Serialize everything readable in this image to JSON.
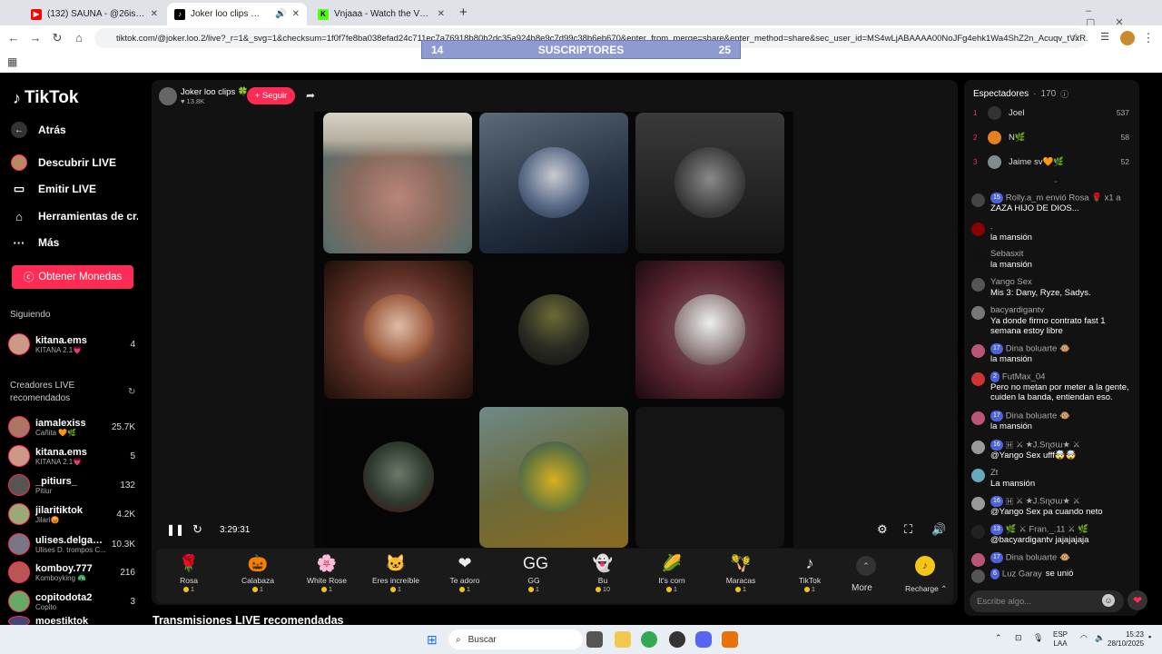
{
  "browser": {
    "tabs": [
      {
        "title": "(132) SAUNA - @26is - YouTube",
        "active": false
      },
      {
        "title": "Joker loo clips 🍀 (@joker.l",
        "active": true
      },
      {
        "title": "Vnjaaa - Watch the VOD on Kick",
        "active": false
      }
    ],
    "new_tab": "+",
    "url": "tiktok.com/@joker.loo.2/live?_r=1&_svg=1&checksum=1f0f7fe8ba038efad24c711ec7a76918b80b2dc35a924b8e9c7d99c38b6eb670&enter_from_merge=share&enter_method=share&sec_user_id=MS4wLjABAAAA00NoJFg4ehk1Wa4ShZ2n_Acuqv_tVxR..."
  },
  "overlay": {
    "left": "14",
    "label": "SUSCRIPTORES",
    "right": "25"
  },
  "sidebar": {
    "logo": "TikTok",
    "nav": [
      {
        "label": "Atrás",
        "icon": "arrow-left-icon"
      },
      {
        "label": "Descubrir LIVE",
        "icon": "live-avatar-icon"
      },
      {
        "label": "Emitir LIVE",
        "icon": "camera-icon"
      },
      {
        "label": "Herramientas de cr...",
        "icon": "house-icon"
      },
      {
        "label": "Más",
        "icon": "more-icon"
      }
    ],
    "coins_button": "Obtener Monedas",
    "following_title": "Siguiendo",
    "following": [
      {
        "name": "kitana.ems",
        "sub": "KITANA 2.1💗",
        "count": "4"
      }
    ],
    "recommended_title": "Creadores LIVE recomendados",
    "recommended": [
      {
        "name": "iamalexiss",
        "sub": "Cañita 🧡🌿",
        "count": "25.7K"
      },
      {
        "name": "kitana.ems",
        "sub": "KITANA 2.1💗",
        "count": "5"
      },
      {
        "name": "_pitiurs_",
        "sub": "Pitiur",
        "count": "132"
      },
      {
        "name": "jilaritiktok",
        "sub": "Jilari😡",
        "count": "4.2K"
      },
      {
        "name": "ulises.delgad...",
        "sub": "Ulises D. trompos C...",
        "count": "10.3K"
      },
      {
        "name": "komboy.777",
        "sub": "Komboyking 🦚",
        "count": "216"
      },
      {
        "name": "copitodota2",
        "sub": "Copito",
        "count": "3"
      },
      {
        "name": "moestiktok",
        "sub": "",
        "count": ""
      }
    ]
  },
  "stream": {
    "host_name": "Joker loo clips 🍀",
    "host_likes": "13.8K",
    "follow_button": "+ Seguir",
    "time": "3:29:31",
    "more_label": "More",
    "recharge_label": "Recharge ⌃"
  },
  "gifts": [
    {
      "name": "Rosa",
      "price": "1",
      "icon": "🌹"
    },
    {
      "name": "Calabaza",
      "price": "1",
      "icon": "🎃"
    },
    {
      "name": "White Rose",
      "price": "1",
      "icon": "🌸"
    },
    {
      "name": "Eres increíble",
      "price": "1",
      "icon": "🐱"
    },
    {
      "name": "Te adoro",
      "price": "1",
      "icon": "❤"
    },
    {
      "name": "GG",
      "price": "1",
      "icon": "GG"
    },
    {
      "name": "Bu",
      "price": "10",
      "icon": "👻"
    },
    {
      "name": "It's corn",
      "price": "1",
      "icon": "🌽"
    },
    {
      "name": "Maracas",
      "price": "1",
      "icon": "🪇"
    },
    {
      "name": "TikTok",
      "price": "1",
      "icon": "♪"
    }
  ],
  "viewers_panel": {
    "title": "Espectadores",
    "count": "170",
    "top": [
      {
        "rank": "1",
        "name": "Joel",
        "score": "537",
        "color": "#333333"
      },
      {
        "rank": "2",
        "name": "N🌿",
        "score": "58",
        "color": "#e67e22"
      },
      {
        "rank": "3",
        "name": "Jaime sv🧡🌿",
        "score": "52",
        "color": "#7f8c8d"
      }
    ]
  },
  "chat": [
    {
      "user": "Rolly.a_m envió Rosa 🌹 x1 a",
      "msg": "ZAZA HIJO DE DIOS...",
      "level": "15",
      "color": "#444"
    },
    {
      "user": ".",
      "msg": "la mansión",
      "level": "",
      "color": "#8b0000"
    },
    {
      "user": "Sebasxit",
      "msg": "la mansión",
      "level": "",
      "color": "#111"
    },
    {
      "user": "Yango Sex",
      "msg": "Mis 3: Dany, Ryze, Sadys.",
      "level": "",
      "color": "#555"
    },
    {
      "user": "bacyardigantv",
      "msg": "Ya donde firmo contrato fast 1 semana estoy libre",
      "level": "",
      "color": "#777"
    },
    {
      "user": "Dina boluarte 🐵",
      "msg": "la mansión",
      "level": "17",
      "color": "#b57"
    },
    {
      "user": "FutMax_04",
      "msg": "Pero no metan por meter a la gente, cuiden la banda, entiendan eso.",
      "level": "2",
      "color": "#c33"
    },
    {
      "user": "Dina boluarte 🐵",
      "msg": "la mansión",
      "level": "17",
      "color": "#b57"
    },
    {
      "user": "🇭 ⚔ ★J.Sɳσɯ★ ⚔",
      "msg": "@Yango Sex ufff🤯🤯",
      "level": "16",
      "color": "#999"
    },
    {
      "user": "Zt",
      "msg": "La mansión",
      "level": "",
      "color": "#6ab"
    },
    {
      "user": "🇭 ⚔ ★J.Sɳσɯ★ ⚔",
      "msg": "@Yango Sex pa cuando neto",
      "level": "16",
      "color": "#999"
    },
    {
      "user": "🌿 ⚔ Fran._.11 ⚔ 🌿",
      "msg": "@bacyardigantv jajajajaja",
      "level": "13",
      "color": "#222"
    },
    {
      "user": "Dina boluarte 🐵",
      "msg": "",
      "level": "17",
      "color": "#b57"
    },
    {
      "user": "Luz Garay",
      "msg": "se unió",
      "level": "6",
      "color": "#555"
    }
  ],
  "chat_placeholder": "Escribe algo...",
  "recommended_heading": "Transmisiones LIVE recomendadas",
  "taskbar": {
    "search": "Buscar",
    "lang1": "ESP",
    "lang2": "LAA",
    "time": "15:23",
    "date": "28/10/2025"
  }
}
